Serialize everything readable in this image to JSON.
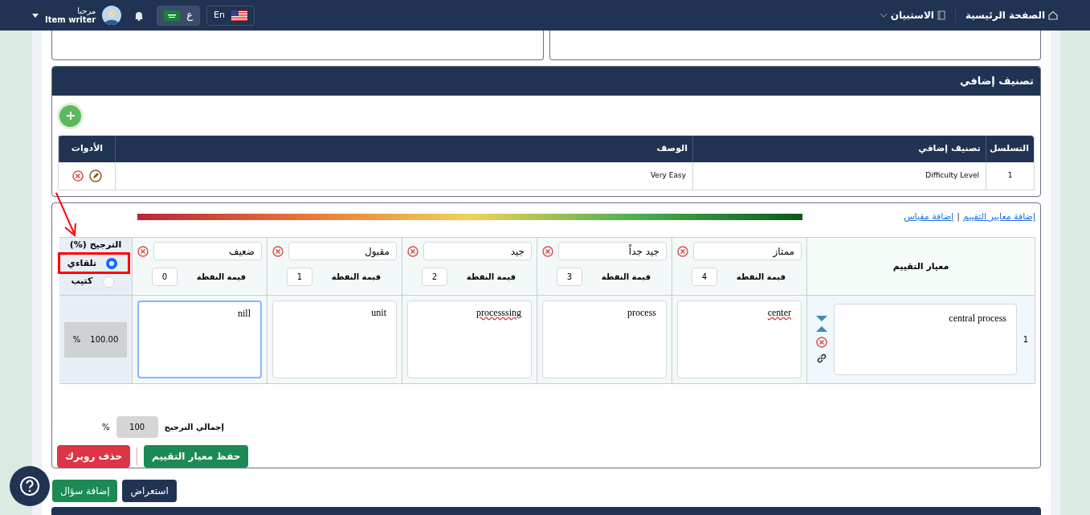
{
  "navbar": {
    "home": "الصفحة الرئيسية",
    "survey": "الاستبيان",
    "languages": [
      {
        "label": "En",
        "kind": "us",
        "selected": false
      },
      {
        "label": "ع",
        "kind": "sa",
        "selected": true
      }
    ],
    "greeting": "مرحبا",
    "user": "Item writer"
  },
  "classification": {
    "title": "تصنيف إضافي",
    "columns": [
      "التسلسل",
      "تصنيف إضافي",
      "الوصف",
      "الأدوات"
    ],
    "rows": [
      {
        "index": "1",
        "classification": "Difficulty Level",
        "description": "Very Easy"
      }
    ]
  },
  "rubric": {
    "links": [
      "إضافة معايير التقييم",
      "إضافة مقياس"
    ],
    "link_separator": "|",
    "criterion_header": "معيار التقييم",
    "weight_header": "الترجيح (%)",
    "weight_modes": [
      {
        "label": "تلقاءي",
        "selected": true
      },
      {
        "label": "كتيب",
        "selected": false
      }
    ],
    "levels": [
      {
        "name": "ممتاز",
        "points_label": "قيمة النقطة",
        "points": "4"
      },
      {
        "name": "جيد جداً",
        "points_label": "قيمة النقطة",
        "points": "3"
      },
      {
        "name": "جيد",
        "points_label": "قيمة النقطة",
        "points": "2"
      },
      {
        "name": "مقبول",
        "points_label": "قيمة النقطة",
        "points": "1"
      },
      {
        "name": "ضعيف",
        "points_label": "قيمة النقطة",
        "points": "0"
      }
    ],
    "rows": [
      {
        "index": "1",
        "criterion": "central process",
        "weight": "100.00",
        "weight_unit": "%",
        "cells": [
          {
            "text": "center",
            "misspelled": true,
            "focused": false
          },
          {
            "text": "process",
            "misspelled": false,
            "focused": false
          },
          {
            "text": "processsing",
            "misspelled": true,
            "focused": false
          },
          {
            "text": "unit",
            "misspelled": false,
            "focused": false
          },
          {
            "text": "nill",
            "misspelled": false,
            "focused": true
          }
        ]
      }
    ],
    "total_label": "إجمالي الترجيح",
    "total": "100",
    "total_unit": "%",
    "buttons": [
      {
        "label": "حفظ معيار التقييم",
        "kind": "save"
      },
      {
        "label": "حذف روبرك",
        "kind": "delete"
      }
    ]
  },
  "actions": [
    {
      "label": "استعراض",
      "kind": "preview"
    },
    {
      "label": "إضافة سؤال",
      "kind": "add"
    }
  ]
}
